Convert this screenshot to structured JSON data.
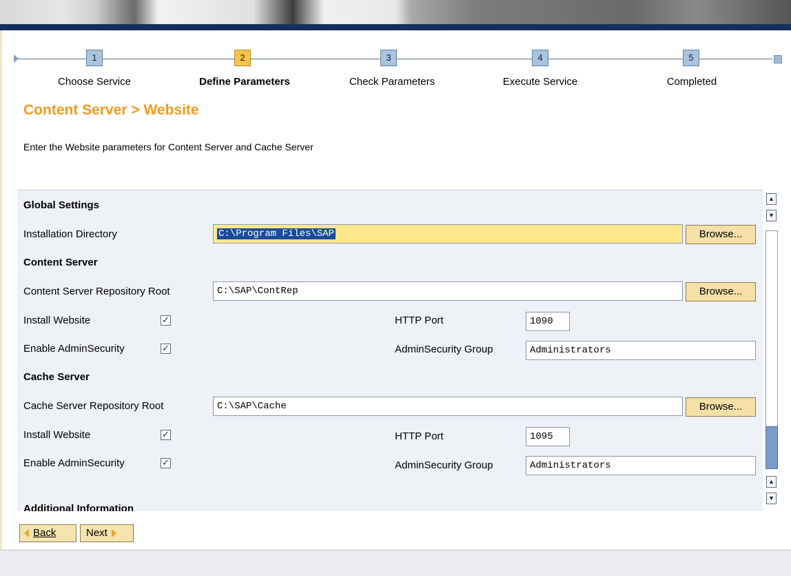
{
  "roadmap": {
    "steps": [
      {
        "number": "1",
        "label": "Choose Service"
      },
      {
        "number": "2",
        "label": "Define Parameters"
      },
      {
        "number": "3",
        "label": "Check Parameters"
      },
      {
        "number": "4",
        "label": "Execute Service"
      },
      {
        "number": "5",
        "label": "Completed"
      }
    ],
    "active_step": 2
  },
  "page": {
    "title": "Content Server > Website",
    "subtitle": "Enter the Website parameters for Content Server and Cache Server"
  },
  "global_settings": {
    "heading": "Global Settings",
    "install_dir_label": "Installation Directory",
    "install_dir_value": "C:\\Program Files\\SAP",
    "browse_label": "Browse..."
  },
  "content_server": {
    "heading": "Content Server",
    "repo_root_label": "Content Server Repository Root",
    "repo_root_value": "C:\\SAP\\ContRep",
    "browse_label": "Browse...",
    "install_website_label": "Install Website",
    "install_website_checked": true,
    "enable_admin_label": "Enable AdminSecurity",
    "enable_admin_checked": true,
    "http_port_label": "HTTP Port",
    "http_port_value": "1090",
    "admin_group_label": "AdminSecurity Group",
    "admin_group_value": "Administrators"
  },
  "cache_server": {
    "heading": "Cache Server",
    "repo_root_label": "Cache Server Repository Root",
    "repo_root_value": "C:\\SAP\\Cache",
    "browse_label": "Browse...",
    "install_website_label": "Install Website",
    "install_website_checked": true,
    "enable_admin_label": "Enable AdminSecurity",
    "enable_admin_checked": true,
    "http_port_label": "HTTP Port",
    "http_port_value": "1095",
    "admin_group_label": "AdminSecurity Group",
    "admin_group_value": "Administrators"
  },
  "additional": {
    "heading": "Additional Information"
  },
  "footer": {
    "back_label": "Back",
    "next_label": "Next"
  },
  "colors": {
    "accent_orange": "#f19a1f",
    "active_step": "#f7c34a",
    "inactive_step": "#a9c4df",
    "banner_bar": "#12305a"
  },
  "icons": {
    "checkbox": "check-icon",
    "scroll_up": "arrow-up-icon",
    "scroll_down": "arrow-down-icon",
    "back": "arrow-left-icon",
    "next": "arrow-right-icon"
  }
}
